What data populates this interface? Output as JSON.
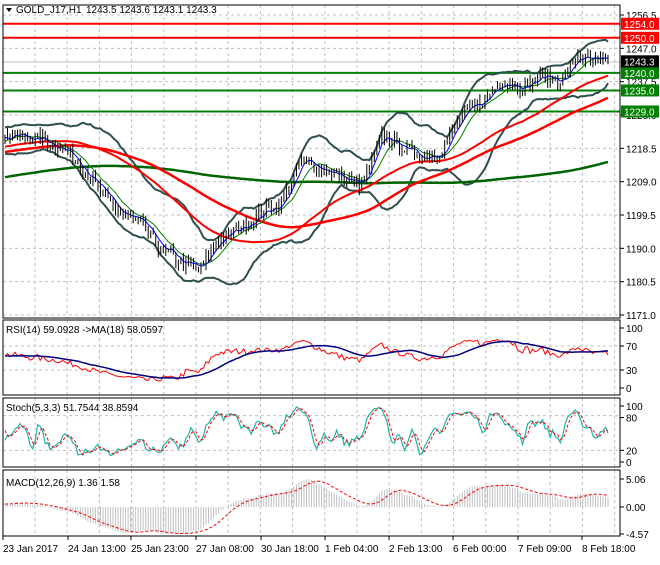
{
  "header": {
    "symbol": "GOLD_J17,H1",
    "ohlc": "1243.5 1243.6 1243.1 1243.3",
    "menu_icon": "triangle-down-icon"
  },
  "chart_data": {
    "type": "candlestick",
    "price_axis": {
      "range": [
        1171.0,
        1256.5
      ],
      "ticks": [
        "1256.5",
        "1247.0",
        "1237.5",
        "1228.0",
        "1218.5",
        "1209.0",
        "1199.5",
        "1190.0",
        "1180.5",
        "1171.0"
      ]
    },
    "current_price": {
      "value": 1243.3,
      "label": "1243.3",
      "color": "#000000"
    },
    "levels": [
      {
        "value": 1254.0,
        "label": "1254.0",
        "color": "#ff0000"
      },
      {
        "value": 1250.0,
        "label": "1250.0",
        "color": "#ff0000"
      },
      {
        "value": 1240.0,
        "label": "1240.0",
        "color": "#008000"
      },
      {
        "value": 1235.0,
        "label": "1235.0",
        "color": "#008000"
      },
      {
        "value": 1229.0,
        "label": "1229.0",
        "color": "#008000"
      }
    ],
    "approx_close_path": [
      [
        0,
        1222
      ],
      [
        6,
        1222
      ],
      [
        14,
        1221
      ],
      [
        22,
        1219
      ],
      [
        30,
        1214
      ],
      [
        38,
        1206
      ],
      [
        46,
        1200
      ],
      [
        54,
        1197
      ],
      [
        62,
        1190
      ],
      [
        70,
        1186
      ],
      [
        78,
        1184
      ],
      [
        84,
        1192
      ],
      [
        94,
        1196
      ],
      [
        102,
        1200
      ],
      [
        110,
        1203
      ],
      [
        118,
        1215
      ],
      [
        126,
        1213
      ],
      [
        134,
        1210
      ],
      [
        142,
        1208
      ],
      [
        150,
        1222
      ],
      [
        158,
        1219
      ],
      [
        166,
        1216
      ],
      [
        174,
        1218
      ],
      [
        182,
        1228
      ],
      [
        190,
        1232
      ],
      [
        198,
        1238
      ],
      [
        206,
        1236
      ],
      [
        214,
        1239
      ],
      [
        222,
        1238
      ],
      [
        228,
        1245
      ],
      [
        234,
        1243
      ],
      [
        240,
        1243.3
      ]
    ],
    "x_labels": [
      "23 Jan 2017",
      "24 Jan 13:00",
      "25 Jan 23:00",
      "27 Jan 08:00",
      "30 Jan 18:00",
      "1 Feb 04:00",
      "2 Feb 13:00",
      "6 Feb 00:00",
      "7 Feb 09:00",
      "8 Feb 18:00"
    ],
    "indicators": {
      "rsi": {
        "label": "RSI(14) 59.0928  ->MA(18) 58.0597",
        "ticks": [
          "100",
          "70",
          "30",
          "0"
        ],
        "line_color": "#ff0000",
        "ma_color": "#000080"
      },
      "stoch": {
        "label": "Stoch(5,3,3) 51.7544 38.8594",
        "ticks": [
          "100",
          "80",
          "20",
          "0"
        ],
        "main_color": "#20b2aa",
        "signal_color": "#ff0000"
      },
      "macd": {
        "label": "MACD(12,26,9) 1.36 1.58",
        "ticks": [
          "5.06",
          "0.00",
          "-4.57"
        ],
        "range": [
          -4.57,
          5.06
        ],
        "hist_color": "#c0c0c0",
        "signal_color": "#ff0000"
      }
    },
    "grid": true
  }
}
